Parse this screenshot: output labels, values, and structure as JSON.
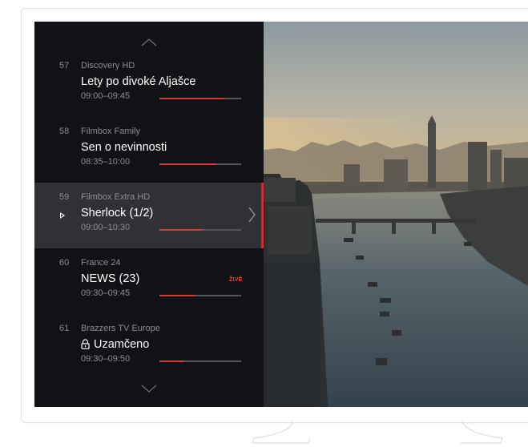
{
  "nav": {
    "up_icon": "chevron-up-icon",
    "down_icon": "chevron-down-icon"
  },
  "channels": [
    {
      "number": "57",
      "name": "Discovery HD",
      "title": "Lety po divoké Aljašce",
      "time": "09:00–09:45",
      "progress": 0.78
    },
    {
      "number": "58",
      "name": "Filmbox Family",
      "title": "Sen o nevinnosti",
      "time": "08:35–10:00",
      "progress": 0.7
    },
    {
      "number": "59",
      "name": "Filmbox Extra HD",
      "title": "Sherlock (1/2)",
      "time": "09:00–10:30",
      "progress": 0.52,
      "selected": true,
      "playing": true
    },
    {
      "number": "60",
      "name": "France 24",
      "title": "NEWS (23)",
      "time": "09:30–09:45",
      "progress": 0.43,
      "badge": "ŽIVĚ"
    },
    {
      "number": "61",
      "name": "Brazzers TV Europe",
      "title": "Uzamčeno",
      "time": "09:30–09:50",
      "progress": 0.3,
      "locked": true
    }
  ],
  "colors": {
    "accent": "#d63a35",
    "sidebar_bg": "#111215",
    "selected_bg": "#2f3135",
    "muted_text": "#8b8d92"
  }
}
